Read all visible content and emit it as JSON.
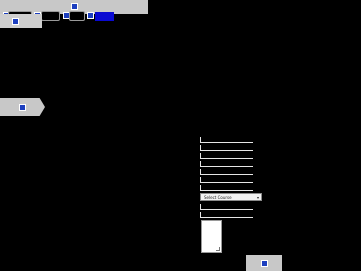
{
  "toolbar": {
    "icons": [
      "toolbar-app-icon",
      "toolbar-icon-1",
      "toolbar-icon-2",
      "toolbar-icon-3",
      "toolbar-icon-4"
    ],
    "accent_color": "#0a0ad2",
    "background_color": "#c8c8c8"
  },
  "left_panel": {
    "icon": "panel-icon"
  },
  "form": {
    "select": {
      "value": "Select Course"
    }
  },
  "bottom_panel": {
    "icon": "panel-icon"
  },
  "colors": {
    "page_background": "#000000",
    "panel_gray": "#c8c8c8",
    "accent_blue": "#0a0ad2"
  }
}
